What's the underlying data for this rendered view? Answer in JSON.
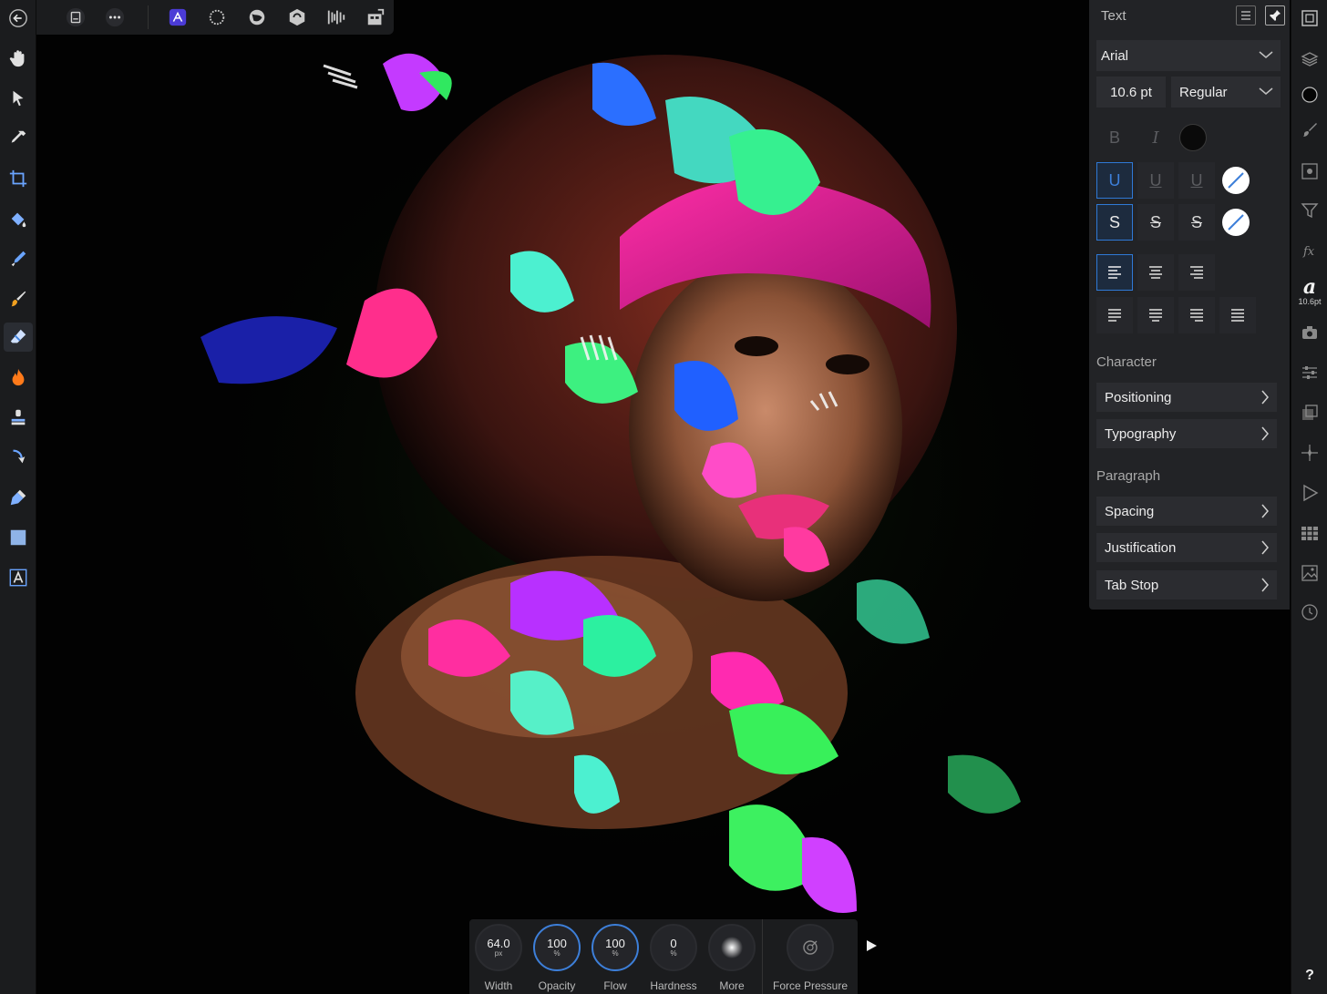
{
  "panel": {
    "title": "Text",
    "font_family": "Arial",
    "font_size": "10.6 pt",
    "font_style": "Regular",
    "bold_label": "B",
    "italic_label": "I",
    "underline_labels": [
      "U",
      "U",
      "U"
    ],
    "strike_labels": [
      "S",
      "S",
      "S"
    ],
    "character_section": "Character",
    "character_items": [
      "Positioning",
      "Typography"
    ],
    "paragraph_section": "Paragraph",
    "paragraph_items": [
      "Spacing",
      "Justification",
      "Tab Stop"
    ],
    "colors": {
      "accent": "#2f79d6",
      "text_color": "#0a0a0a"
    }
  },
  "right_strip": {
    "character_glyph": "a",
    "character_size": "10.6pt",
    "help": "?"
  },
  "brush_bar": {
    "width": {
      "value": "64.0",
      "unit": "px",
      "label": "Width"
    },
    "opacity": {
      "value": "100",
      "unit": "%",
      "label": "Opacity"
    },
    "flow": {
      "value": "100",
      "unit": "%",
      "label": "Flow"
    },
    "hardness": {
      "value": "0",
      "unit": "%",
      "label": "Hardness"
    },
    "more_label": "More",
    "force_pressure_label": "Force Pressure"
  },
  "toolbar": {
    "left_tools": [
      "hand-icon",
      "move-icon",
      "color-picker-icon",
      "crop-icon",
      "flood-fill-icon",
      "selection-brush-icon",
      "paint-brush-icon",
      "erase-brush-icon",
      "dodge-burn-icon",
      "clone-icon",
      "smudge-icon",
      "pen-icon",
      "rectangle-icon",
      "text-icon"
    ],
    "top_tools": [
      "back-icon",
      "document-icon",
      "more-icon",
      "photo-persona-icon",
      "liquify-persona-icon",
      "develop-persona-icon",
      "tone-mapping-persona-icon",
      "export-persona-icon",
      "assistant-icon"
    ]
  }
}
